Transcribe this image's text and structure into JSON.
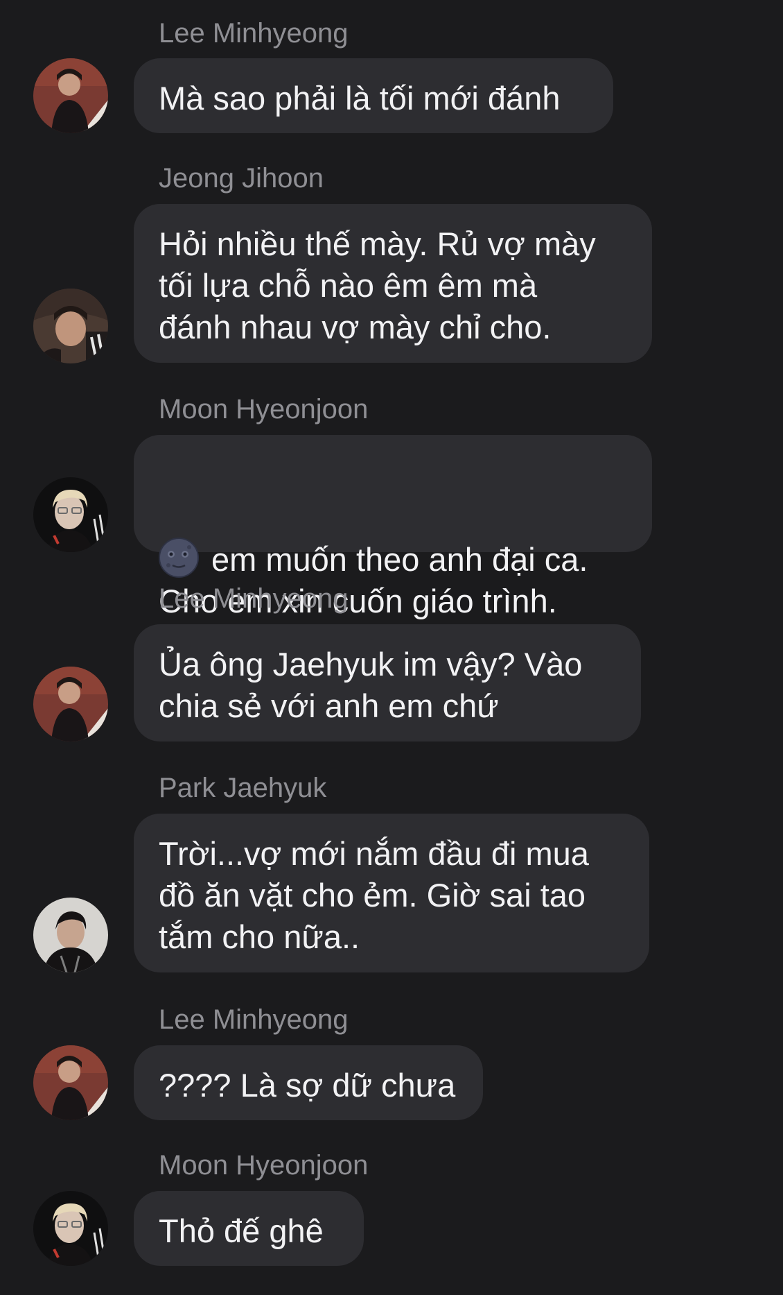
{
  "messages": [
    {
      "sender": "Lee Minhyeong",
      "avatar": "avatar-lee-minhyeong",
      "text": "Mà sao phải là tối mới đánh"
    },
    {
      "sender": "Jeong Jihoon",
      "avatar": "avatar-jeong-jihoon",
      "text": "Hỏi nhiều thế mày. Rủ vợ mày\ntối lựa chỗ nào êm êm mà\nđánh nhau vợ mày chỉ cho."
    },
    {
      "sender": "Moon Hyeonjoon",
      "avatar": "avatar-moon-hyeonjoon",
      "emoji": "new-moon-face-emoji",
      "text": "em muốn theo anh đại ca.\nCho em xin cuốn giáo trình."
    },
    {
      "sender": "Lee Minhyeong",
      "avatar": "avatar-lee-minhyeong",
      "text": "Ủa ông Jaehyuk im vậy? Vào\nchia sẻ với anh em chứ"
    },
    {
      "sender": "Park Jaehyuk",
      "avatar": "avatar-park-jaehyuk",
      "text": "Trời...vợ mới nắm đầu đi mua\nđồ ăn vặt cho ẻm. Giờ sai tao\ntắm cho nữa.."
    },
    {
      "sender": "Lee Minhyeong",
      "avatar": "avatar-lee-minhyeong",
      "text": "???? Là sợ dữ chưa"
    },
    {
      "sender": "Moon Hyeonjoon",
      "avatar": "avatar-moon-hyeonjoon",
      "text": "Thỏ đế ghê"
    }
  ],
  "colors": {
    "background": "#1b1b1d",
    "bubble": "#2d2d31",
    "sender_name": "#8f8f94",
    "message_text": "#f2f2f4"
  }
}
